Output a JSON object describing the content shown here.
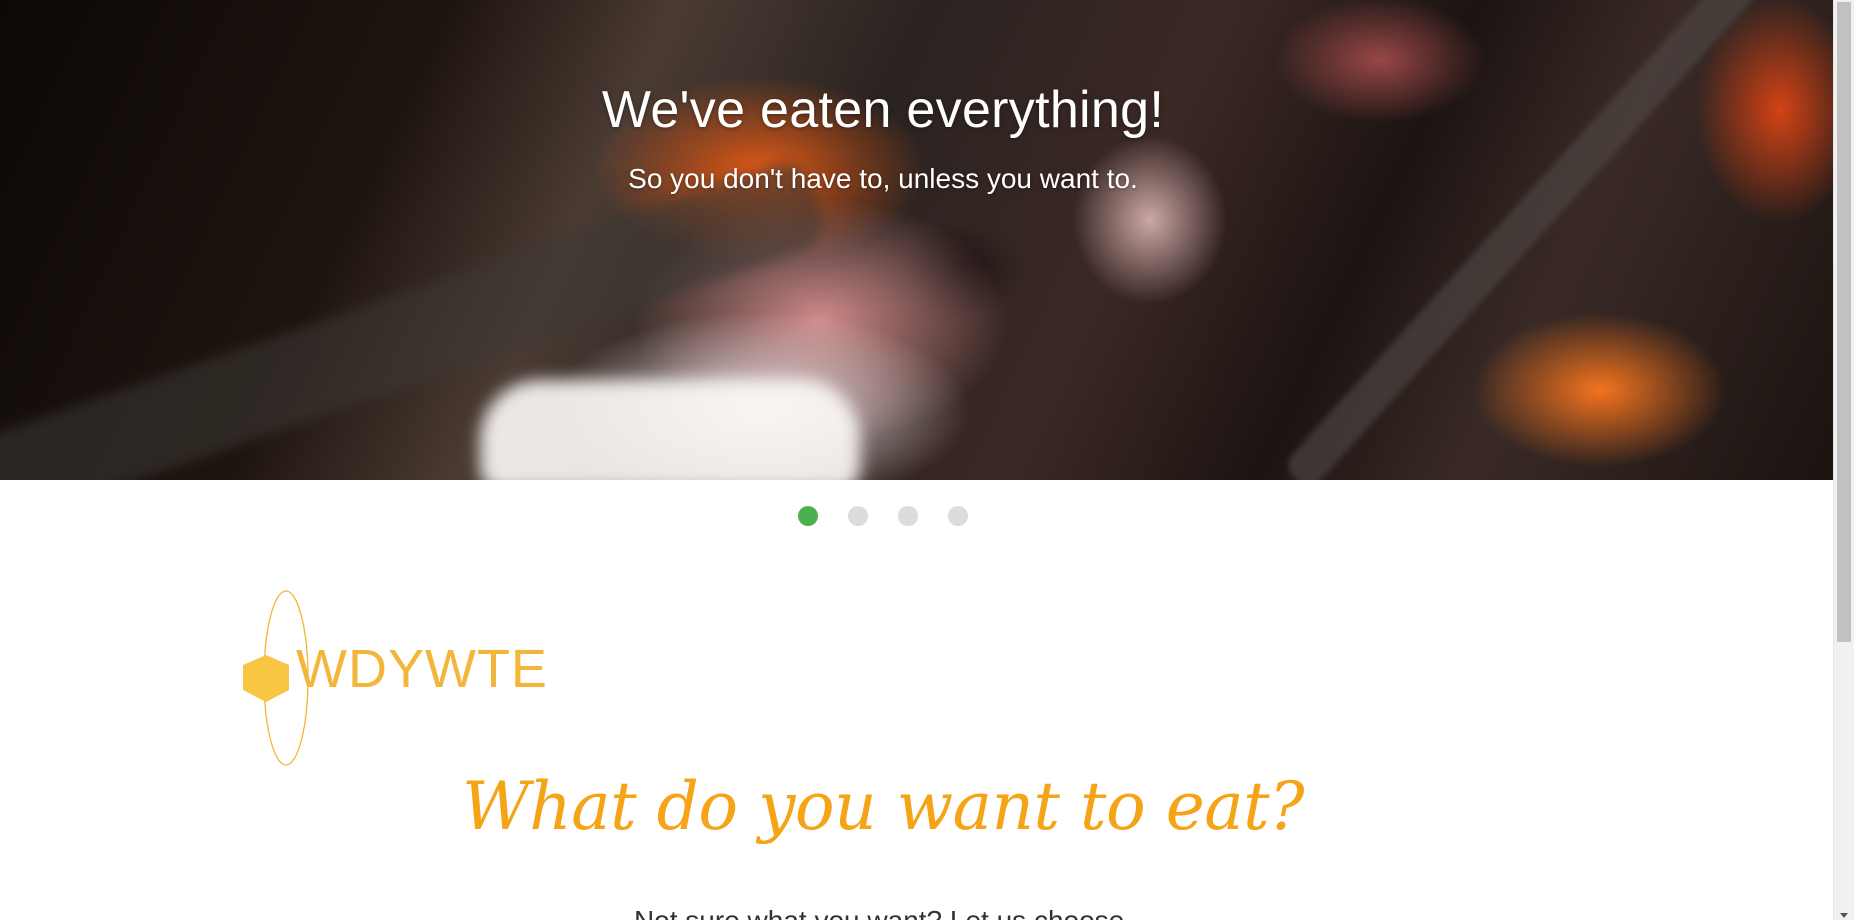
{
  "hero": {
    "title": "We've eaten everything!",
    "subtitle": "So you don't have to, unless you want to.",
    "slide_count": 4,
    "active_slide": 1
  },
  "carousel_dots": {
    "active_color": "#4caf50",
    "inactive_color": "#dcdcdc"
  },
  "logo": {
    "text": "WDYWTE",
    "icon": "hexagon-icon",
    "color": "#f3b63a"
  },
  "main": {
    "headline": "What do you want to eat?",
    "subline": "Not sure what you want? Let us choose.",
    "headline_color": "#f5a317"
  }
}
